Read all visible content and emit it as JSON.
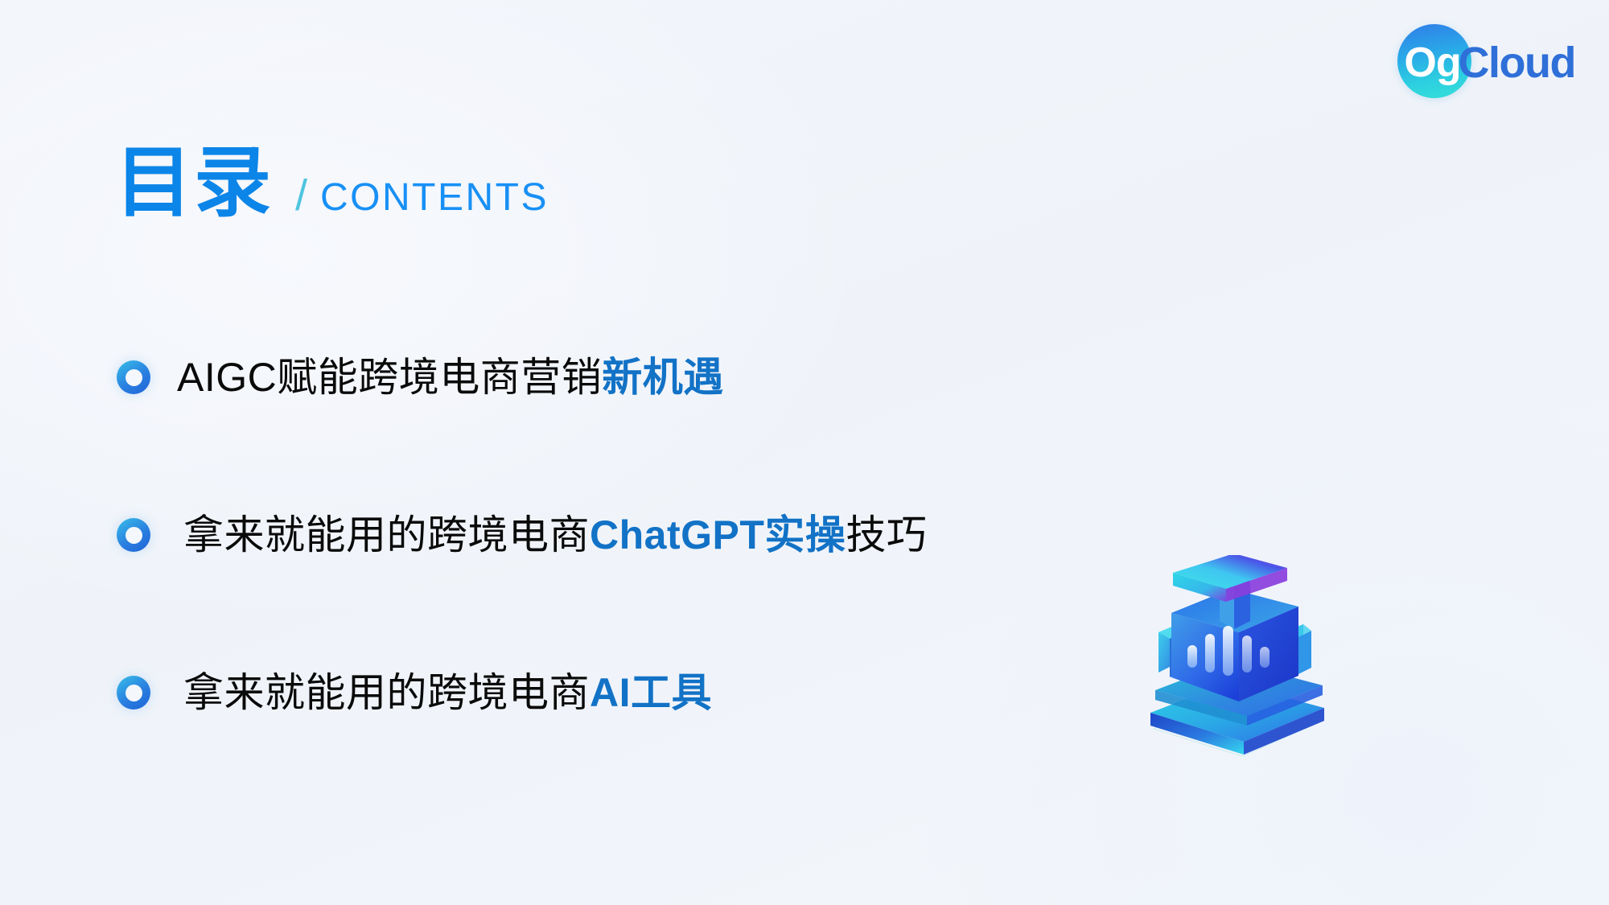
{
  "brand": {
    "logo_mark_text": "Og",
    "logo_word": "Cloud",
    "logo_circle_gradient_start": "#2f7de8",
    "logo_circle_gradient_end": "#35e0d8",
    "logo_word_color": "#2f6fd8"
  },
  "heading": {
    "title_cn": "目录",
    "separator": "/",
    "title_en": "CONTENTS",
    "title_color": "#0c85e8",
    "separator_color": "#4fc4e0",
    "title_en_color": "#1890f5"
  },
  "contents": {
    "items": [
      {
        "index": "1",
        "bullet_icon": "ring-bullet-icon",
        "segments": [
          {
            "text": "AIGC赋能跨境电商营销",
            "highlight": false
          },
          {
            "text": "新机遇",
            "highlight": true
          }
        ],
        "full_text": "AIGC赋能跨境电商营销新机遇"
      },
      {
        "index": "2",
        "bullet_icon": "ring-bullet-icon",
        "segments": [
          {
            "text": "拿来就能用的跨境电商",
            "highlight": false
          },
          {
            "text": "ChatGPT实操",
            "highlight": true
          },
          {
            "text": "技巧",
            "highlight": false
          }
        ],
        "full_text": "拿来就能用的跨境电商ChatGPT实操技巧"
      },
      {
        "index": "3",
        "bullet_icon": "ring-bullet-icon",
        "segments": [
          {
            "text": "拿来就能用的跨境电商",
            "highlight": false
          },
          {
            "text": "AI工具",
            "highlight": true
          }
        ],
        "full_text": "拿来就能用的跨境电商AI工具"
      }
    ],
    "text_color": "#0a0a0a",
    "highlight_color": "#1272c6"
  },
  "decoration": {
    "illustration_name": "isometric-ai-robot-illustration",
    "illustration_colors": {
      "top_bar_cyan": "#3ee0e8",
      "top_bar_purple": "#a03ce0",
      "body_blue": "#2f6ae8",
      "body_deep": "#1b3fd8",
      "base_cyan": "#2fd8e8",
      "base_blue": "#1f5ae0",
      "outline": "#8fe6e0"
    }
  },
  "background": {
    "base_color": "#f0f3f9",
    "tint_color": "#eef3fb"
  }
}
